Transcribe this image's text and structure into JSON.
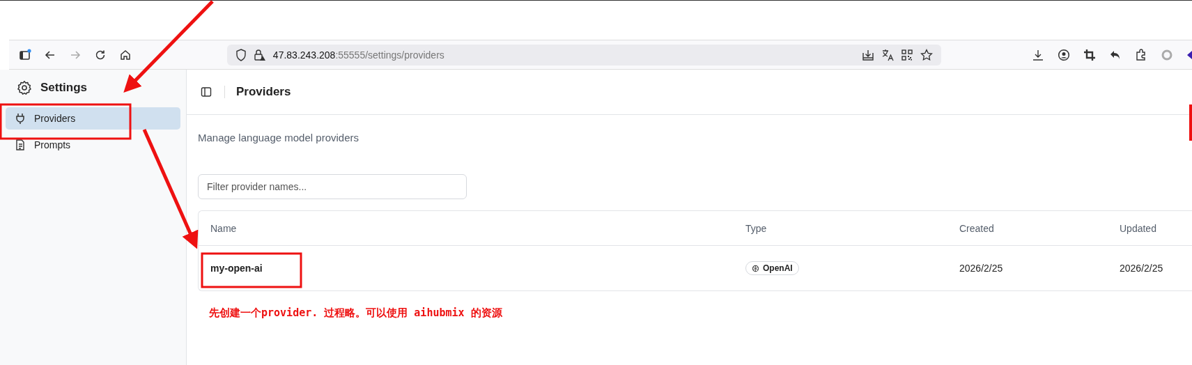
{
  "browser": {
    "url_host": "47.83.243.208",
    "url_rest": ":55555/settings/providers"
  },
  "sidebar": {
    "title": "Settings",
    "items": [
      {
        "label": "Providers",
        "selected": true
      },
      {
        "label": "Prompts",
        "selected": false
      }
    ]
  },
  "header": {
    "title": "Providers"
  },
  "description": "Manage language model providers",
  "filter": {
    "placeholder": "Filter provider names..."
  },
  "table": {
    "columns": [
      "Name",
      "Type",
      "Created",
      "Updated"
    ],
    "rows": [
      {
        "name": "my-open-ai",
        "type": "OpenAI",
        "created": "2026/2/25",
        "updated": "2026/2/25"
      }
    ]
  },
  "annotation": {
    "note": "先创建一个provider. 过程略。可以使用 aihubmix 的资源"
  }
}
